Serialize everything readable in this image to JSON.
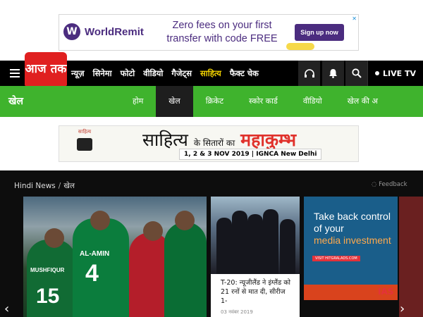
{
  "top_ad": {
    "brand": "WorldRemit",
    "brand_initial": "W",
    "headline": "Zero fees on your first transfer with code FREE",
    "cta": "Sign up now",
    "close": "✕"
  },
  "nav": {
    "logo": "आज तक",
    "links": [
      "न्यूज़",
      "सिनेमा",
      "फोटो",
      "वीडियो",
      "गैजेट्स",
      "साहित्य",
      "फैक्ट चेक"
    ],
    "active_index": 5,
    "live_tv": "LIVE TV"
  },
  "subnav": {
    "title": "खेल",
    "items": [
      "होम",
      "खेल",
      "क्रिकेट",
      "स्कोर कार्ड",
      "वीडियो",
      "खेल की अ"
    ],
    "active_index": 1
  },
  "sahitya_banner": {
    "logo_text": "साहित्य",
    "title_a": "साहित्य",
    "title_b": "के सितारों का",
    "title_c": "महाकुम्भ",
    "dates": "1, 2 & 3 NOV 2019 | IGNCA New Delhi"
  },
  "breadcrumb": {
    "home": "Hindi News",
    "sep": "/",
    "current": "खेल"
  },
  "feedback": "Feedback",
  "hero": {
    "jersey_names": [
      "MUSHFIQUR",
      "AL-AMIN"
    ],
    "jersey_numbers": [
      "15",
      "4"
    ]
  },
  "story2": {
    "title": "T-20: न्यूजीलैंड ने इंग्लैंड को 21 रनों से मात दी, सीरीज 1-",
    "date": "03 नवंबर 2019"
  },
  "ad3": {
    "line1": "Take back control",
    "line2": "of your",
    "line3": "media investment",
    "link": "VISIT HITGRALADS.COM",
    "logo": "IAS"
  },
  "colors": {
    "accent_green": "#3fb32d",
    "brand_red": "#e02020",
    "active_yellow": "#f2d200"
  }
}
